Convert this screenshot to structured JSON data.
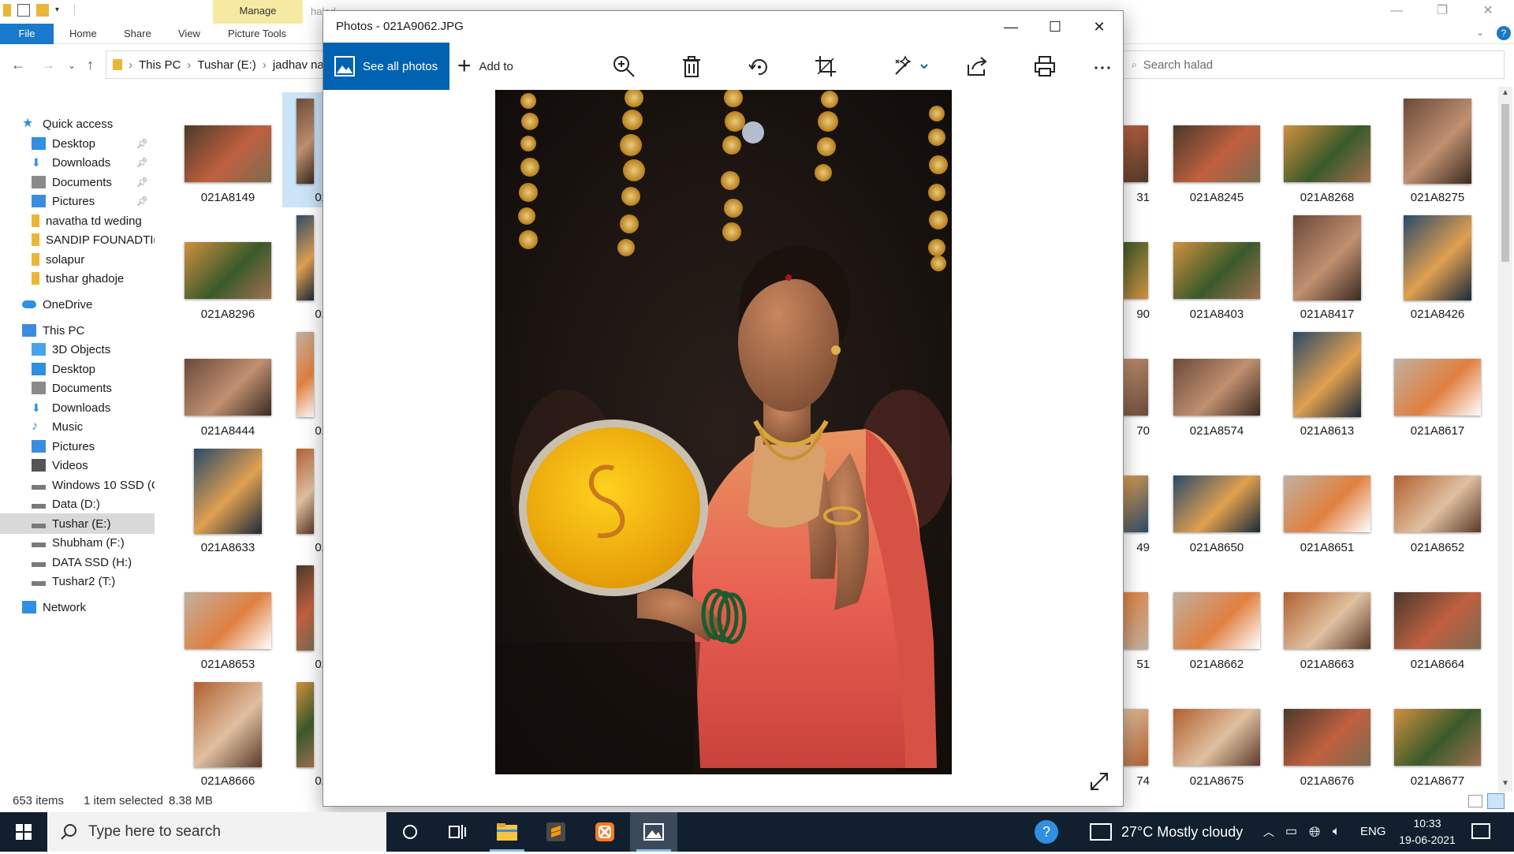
{
  "explorer": {
    "ribbon_manage": "Manage",
    "ribbon_manage_folder": "halad",
    "ribbon_tabs": [
      "File",
      "Home",
      "Share",
      "View",
      "Picture Tools"
    ],
    "address": [
      "This PC",
      "Tushar (E:)",
      "jadhav na"
    ],
    "search_placeholder": "Search halad",
    "sidebar": [
      {
        "label": "Quick access",
        "icon": "star-icon"
      },
      {
        "label": "Desktop",
        "icon": "desktop-icon",
        "pinned": true
      },
      {
        "label": "Downloads",
        "icon": "download-icon",
        "pinned": true
      },
      {
        "label": "Documents",
        "icon": "documents-icon",
        "pinned": true
      },
      {
        "label": "Pictures",
        "icon": "pictures-icon",
        "pinned": true
      },
      {
        "label": "navatha td weding",
        "icon": "folder-icon"
      },
      {
        "label": "SANDIP FOUNADTI(",
        "icon": "folder-icon"
      },
      {
        "label": "solapur",
        "icon": "folder-icon"
      },
      {
        "label": "tushar ghadoje",
        "icon": "folder-icon"
      },
      {
        "label": "OneDrive",
        "icon": "cloud-icon"
      },
      {
        "label": "This PC",
        "icon": "computer-icon"
      },
      {
        "label": "3D Objects",
        "icon": "cube-icon"
      },
      {
        "label": "Desktop",
        "icon": "desktop-icon"
      },
      {
        "label": "Documents",
        "icon": "documents-icon"
      },
      {
        "label": "Downloads",
        "icon": "download-icon"
      },
      {
        "label": "Music",
        "icon": "music-icon"
      },
      {
        "label": "Pictures",
        "icon": "pictures-icon"
      },
      {
        "label": "Videos",
        "icon": "videos-icon"
      },
      {
        "label": "Windows 10 SSD (C",
        "icon": "drive-icon"
      },
      {
        "label": "Data (D:)",
        "icon": "drive-icon"
      },
      {
        "label": "Tushar (E:)",
        "icon": "drive-icon",
        "selected": true
      },
      {
        "label": "Shubham (F:)",
        "icon": "drive-icon"
      },
      {
        "label": "DATA SSD (H:)",
        "icon": "drive-icon"
      },
      {
        "label": "Tushar2 (T:)",
        "icon": "drive-icon"
      },
      {
        "label": "Network",
        "icon": "network-icon"
      }
    ],
    "left_thumbs": [
      "021A8149",
      "021A8296",
      "021A8444",
      "021A8633",
      "021A8653",
      "021A8666"
    ],
    "left_thumbs_partial": [
      "02",
      "02",
      "02",
      "02",
      "02",
      "02"
    ],
    "right_partial": [
      "31",
      "90",
      "70",
      "49",
      "51",
      "74"
    ],
    "right_cols": [
      [
        "021A8245",
        "021A8403",
        "021A8574",
        "021A8650",
        "021A8662",
        "021A8675"
      ],
      [
        "021A8268",
        "021A8417",
        "021A8613",
        "021A8651",
        "021A8663",
        "021A8676"
      ],
      [
        "021A8275",
        "021A8426",
        "021A8617",
        "021A8652",
        "021A8664",
        "021A8677"
      ]
    ],
    "status": {
      "count": "653 items",
      "selected": "1 item selected",
      "size": "8.38 MB"
    }
  },
  "photos": {
    "title": "Photos - 021A9062.JPG",
    "see_all": "See all photos",
    "add_to": "Add to"
  },
  "taskbar": {
    "search_placeholder": "Type here to search",
    "weather": "27°C  Mostly cloudy",
    "lang": "ENG",
    "time": "10:33",
    "date": "19-06-2021"
  }
}
